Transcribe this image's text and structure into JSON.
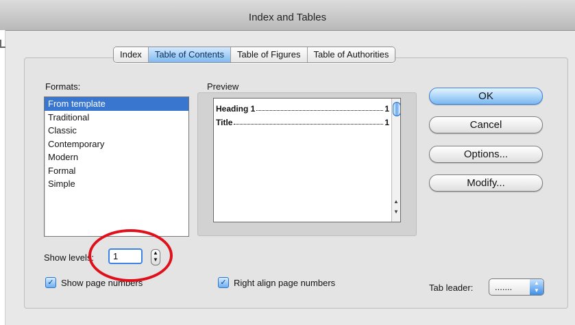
{
  "window": {
    "title": "Index and Tables"
  },
  "tabs": [
    {
      "label": "Index"
    },
    {
      "label": "Table of Contents"
    },
    {
      "label": "Table of Figures"
    },
    {
      "label": "Table of Authorities"
    }
  ],
  "formats": {
    "label": "Formats:",
    "items": [
      "From template",
      "Traditional",
      "Classic",
      "Contemporary",
      "Modern",
      "Formal",
      "Simple"
    ],
    "selected": "From template"
  },
  "preview": {
    "label": "Preview",
    "entries": [
      {
        "text": "Heading 1",
        "page": "1"
      },
      {
        "text": "Title",
        "page": "1"
      }
    ]
  },
  "buttons": {
    "ok": "OK",
    "cancel": "Cancel",
    "options": "Options...",
    "modify": "Modify..."
  },
  "show_levels": {
    "label": "Show levels:",
    "value": "1"
  },
  "checkboxes": {
    "show_page_numbers": {
      "label": "Show page numbers",
      "checked": true
    },
    "right_align_page_numbers": {
      "label": "Right align page numbers",
      "checked": true
    }
  },
  "tab_leader": {
    "label": "Tab leader:",
    "value": "......."
  },
  "annotation": {
    "color": "#e0101a"
  },
  "colors": {
    "accent": "#3876d0",
    "ok_button": "#79b7f2"
  }
}
